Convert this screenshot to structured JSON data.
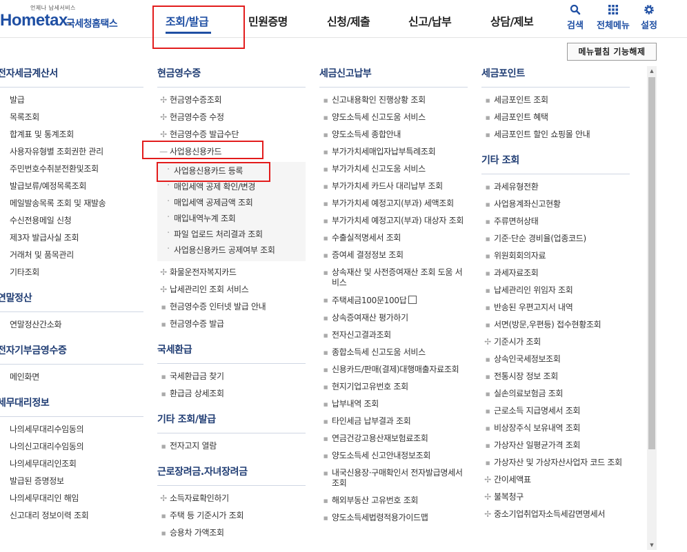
{
  "brand": {
    "tagline": "언제나 납세서비스",
    "name_main": "Hometax",
    "name_dot": ".",
    "name_sub": "국세청홈택스"
  },
  "topnav": [
    "조회/발급",
    "민원증명",
    "신청/제출",
    "신고/납부",
    "상담/제보"
  ],
  "tools": {
    "search": "검색",
    "allmenu": "전체메뉴",
    "settings": "설정"
  },
  "menu_close_button": "메뉴펼침 기능해제",
  "col1": {
    "sections": [
      {
        "title": "전자세금계산서",
        "items": [
          "발급",
          "목록조회",
          "합계표 및 통계조회",
          "사용자유형별 조회권한 관리",
          "주민번호수취분전환및조회",
          "발급보류/예정목록조회",
          "메일발송목록 조회 및 재발송",
          "수신전용메일 신청",
          "제3자 발급사실 조회",
          "거래처 및 품목관리",
          "기타조회"
        ]
      },
      {
        "title": "연말정산",
        "items": [
          "연말정산간소화"
        ]
      },
      {
        "title": "전자기부금영수증",
        "items": [
          "메인화면"
        ]
      },
      {
        "title": "세무대리정보",
        "items": [
          "나의세무대리수임동의",
          "나의신고대리수임동의",
          "나의세무대리인조회",
          "발급된 증명정보",
          "나의세무대리인 해임",
          "신고대리 정보이력 조회"
        ]
      }
    ]
  },
  "col2": {
    "cash_title": "현금영수증",
    "cash_items_top": [
      "현금영수증조회",
      "현금영수증 수정",
      "현금영수증 발급수단"
    ],
    "biz_card_label": "사업용신용카드",
    "biz_card_sub": [
      "사업용신용카드 등록",
      "매입세액 공제 확인/변경",
      "매입세액 공제금액 조회",
      "매입내역누계 조회",
      "파일 업로드 처리결과 조회",
      "사업용신용카드 공제여부 조회"
    ],
    "cash_items_bottom": [
      "화물운전자복지카드",
      "납세관리인 조회 서비스",
      "현금영수증 인터넷 발급 안내",
      "현금영수증 발급"
    ],
    "refund_title": "국세환급",
    "refund_items": [
      "국세환급금 찾기",
      "환급금 상세조회"
    ],
    "etc_title": "기타 조회/발급",
    "etc_items": [
      "전자고지 열람"
    ],
    "eitc_title": "근로장려금.자녀장려금",
    "eitc_items": [
      "소득자료확인하기",
      "주택 등 기준시가 조회",
      "승용차 가액조회"
    ]
  },
  "col3": {
    "title": "세금신고납부",
    "items": [
      "신고내용확인 진행상황 조회",
      "양도소득세 신고도움 서비스",
      "양도소득세 종합안내",
      "부가가치세매입자납부특례조회",
      "부가가치세 신고도움 서비스",
      "부가가치세 카드사 대리납부 조회",
      "부가가치세 예정고지(부과) 세액조회",
      "부가가치세 예정고지(부과) 대상자 조회",
      "수출실적명세서 조회",
      "증여세 결정정보 조회",
      "상속재산 및 사전증여재산 조회 도움 서비스",
      "주택세금100문100답",
      "상속증여재산 평가하기",
      "전자신고결과조회",
      "종합소득세 신고도움 서비스",
      "신용카드/판매(결제)대행매출자료조회",
      "현지기업고유번호 조회",
      "납부내역 조회",
      "타인세금 납부결과 조회",
      "연금건강고용산재보험료조회",
      "양도소득세 신고안내정보조회",
      "내국신용장·구매확인서 전자발급명세서 조회",
      "해외부동산 고유번호 조회",
      "양도소득세법령적용가이드맵"
    ]
  },
  "col4": {
    "point_title": "세금포인트",
    "point_items": [
      "세금포인트 조회",
      "세금포인트 혜택",
      "세금포인트 할인 쇼핑몰 안내"
    ],
    "etc_title": "기타 조회",
    "etc_items": [
      {
        "t": "과세유형전환",
        "m": "sq"
      },
      {
        "t": "사업용계좌신고현황",
        "m": "sq"
      },
      {
        "t": "주류면허상태",
        "m": "sq"
      },
      {
        "t": "기준·단순 경비율(업종코드)",
        "m": "sq"
      },
      {
        "t": "위원회회의자료",
        "m": "sq"
      },
      {
        "t": "과세자료조회",
        "m": "sq"
      },
      {
        "t": "납세관리인 위임자 조회",
        "m": "sq"
      },
      {
        "t": "반송된 우편고지서 내역",
        "m": "sq"
      },
      {
        "t": "서면(방문,우편등) 접수현황조회",
        "m": "sq"
      },
      {
        "t": "기준시가 조회",
        "m": "plus"
      },
      {
        "t": "상속인국세정보조회",
        "m": "sq"
      },
      {
        "t": "전통시장 정보 조회",
        "m": "sq"
      },
      {
        "t": "실손의료보험금 조회",
        "m": "sq"
      },
      {
        "t": "근로소득 지급명세서 조회",
        "m": "sq"
      },
      {
        "t": "비상장주식 보유내역 조회",
        "m": "sq"
      },
      {
        "t": "가상자산 일평균가격 조회",
        "m": "sq"
      },
      {
        "t": "가상자산 및 가상자산사업자 코드 조회",
        "m": "sq"
      },
      {
        "t": "간이세액표",
        "m": "plus"
      },
      {
        "t": "불복청구",
        "m": "plus"
      },
      {
        "t": "중소기업취업자소득세감면명세서",
        "m": "plus"
      }
    ]
  }
}
